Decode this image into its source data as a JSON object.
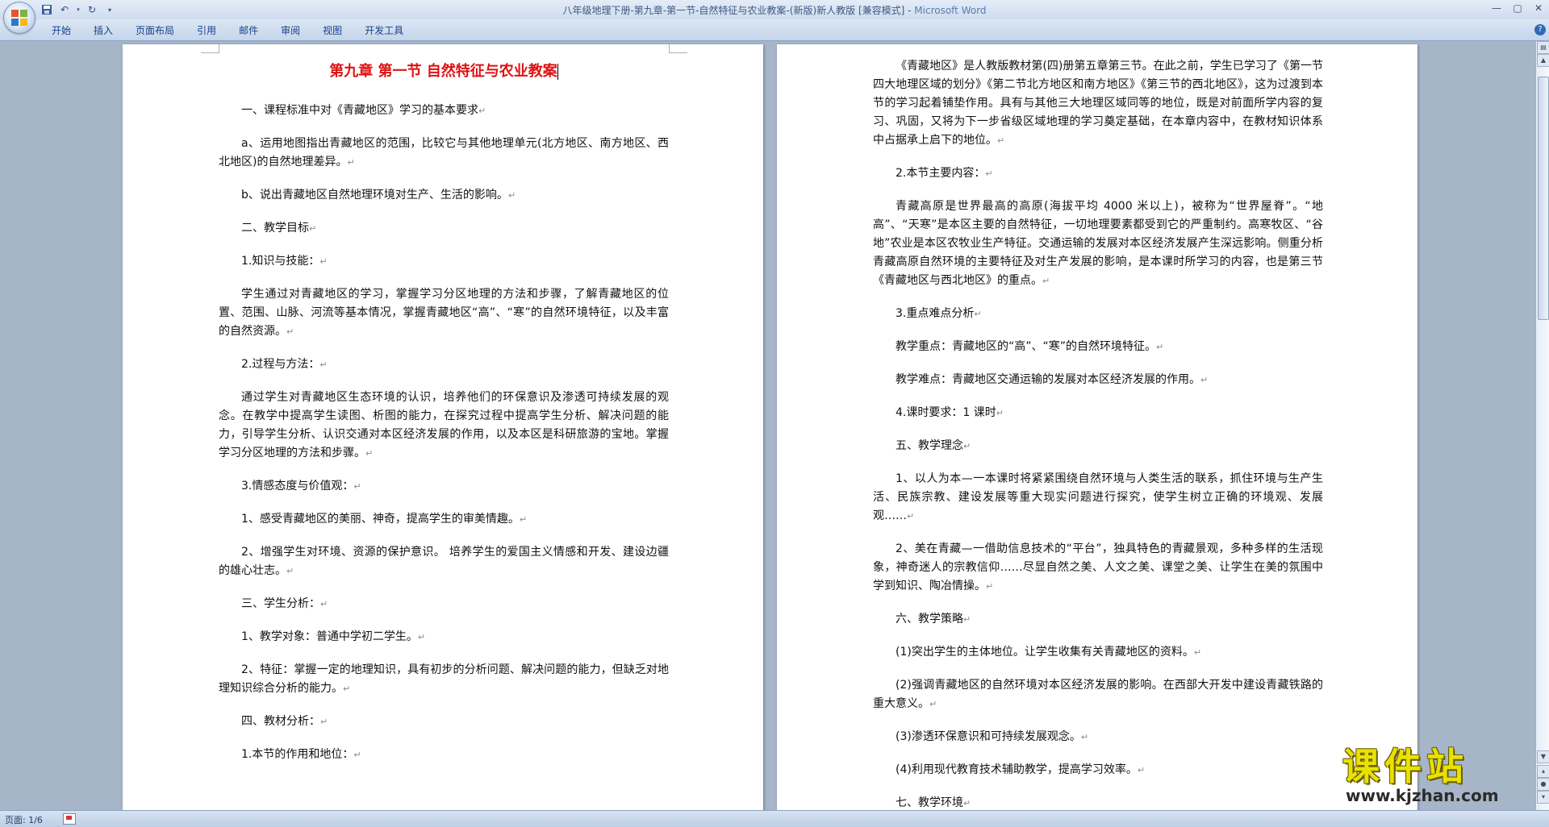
{
  "window": {
    "title": "八年级地理下册-第九章-第一节-自然特征与农业教案-(新版)新人教版 [兼容模式]",
    "separator": " - ",
    "app_name": "Microsoft Word"
  },
  "quick_access": {
    "icons": [
      "save-icon",
      "undo-icon",
      "redo-icon",
      "customize-icon"
    ]
  },
  "ribbon": {
    "tabs": [
      "开始",
      "插入",
      "页面布局",
      "引用",
      "邮件",
      "审阅",
      "视图",
      "开发工具"
    ]
  },
  "doc": {
    "title": "第九章  第一节  自然特征与农业教案",
    "left_paragraphs": [
      {
        "text": "一、课程标准中对《青藏地区》学习的基本要求",
        "indent": true
      },
      {
        "text": "a、运用地图指出青藏地区的范围，比较它与其他地理单元(北方地区、南方地区、西北地区)的自然地理差异。",
        "indent": true
      },
      {
        "text": "b、说出青藏地区自然地理环境对生产、生活的影响。",
        "indent": true
      },
      {
        "text": "二、教学目标",
        "indent": true
      },
      {
        "text": "1.知识与技能：",
        "indent": true
      },
      {
        "text": "学生通过对青藏地区的学习，掌握学习分区地理的方法和步骤，了解青藏地区的位置、范围、山脉、河流等基本情况，掌握青藏地区“高”、“寒”的自然环境特征，以及丰富的自然资源。",
        "indent": true
      },
      {
        "text": "2.过程与方法：",
        "indent": true
      },
      {
        "text": "通过学生对青藏地区生态环境的认识，培养他们的环保意识及渗透可持续发展的观念。在教学中提高学生读图、析图的能力，在探究过程中提高学生分析、解决问题的能力，引导学生分析、认识交通对本区经济发展的作用，以及本区是科研旅游的宝地。掌握学习分区地理的方法和步骤。",
        "indent": true
      },
      {
        "text": "3.情感态度与价值观：",
        "indent": true
      },
      {
        "text": "1、感受青藏地区的美丽、神奇，提高学生的审美情趣。",
        "indent": true
      },
      {
        "text": "2、增强学生对环境、资源的保护意识。 培养学生的爱国主义情感和开发、建设边疆的雄心壮志。",
        "indent": true
      },
      {
        "text": "三、学生分析：",
        "indent": true
      },
      {
        "text": "1、教学对象：普通中学初二学生。",
        "indent": true
      },
      {
        "text": "2、特征：掌握一定的地理知识，具有初步的分析问题、解决问题的能力，但缺乏对地理知识综合分析的能力。",
        "indent": true
      },
      {
        "text": "四、教材分析：",
        "indent": true
      },
      {
        "text": "1.本节的作用和地位：",
        "indent": true
      }
    ],
    "right_paragraphs": [
      {
        "text": "《青藏地区》是人教版教材第(四)册第五章第三节。在此之前，学生已学习了《第一节四大地理区域的划分》《第二节北方地区和南方地区》《第三节的西北地区》，这为过渡到本节的学习起着铺垫作用。具有与其他三大地理区域同等的地位，既是对前面所学内容的复习、巩固，又将为下一步省级区域地理的学习奠定基础，在本章内容中，在教材知识体系中占据承上启下的地位。",
        "indent": true
      },
      {
        "text": "2.本节主要内容：",
        "indent": true
      },
      {
        "text": "青藏高原是世界最高的高原(海拔平均 4000 米以上)，被称为“世界屋脊”。“地高”、“天寒”是本区主要的自然特征，一切地理要素都受到它的严重制约。高寒牧区、“谷地”农业是本区农牧业生产特征。交通运输的发展对本区经济发展产生深远影响。侧重分析青藏高原自然环境的主要特征及对生产发展的影响，是本课时所学习的内容，也是第三节《青藏地区与西北地区》的重点。",
        "indent": true
      },
      {
        "text": "3.重点难点分析",
        "indent": true
      },
      {
        "text": "教学重点：青藏地区的“高”、“寒”的自然环境特征。",
        "indent": true
      },
      {
        "text": "教学难点：青藏地区交通运输的发展对本区经济发展的作用。",
        "indent": true
      },
      {
        "text": "4.课时要求：1 课时",
        "indent": true
      },
      {
        "text": "五、教学理念",
        "indent": true
      },
      {
        "text": "1、以人为本—一本课时将紧紧围绕自然环境与人类生活的联系，抓住环境与生产生活、民族宗教、建设发展等重大现实问题进行探究，使学生树立正确的环境观、发展观……",
        "indent": true
      },
      {
        "text": "2、美在青藏—一借助信息技术的“平台”，独具特色的青藏景观，多种多样的生活现象，神奇迷人的宗教信仰……尽显自然之美、人文之美、课堂之美、让学生在美的氛围中学到知识、陶冶情操。",
        "indent": true
      },
      {
        "text": "六、教学策略",
        "indent": true
      },
      {
        "text": "(1)突出学生的主体地位。让学生收集有关青藏地区的资料。",
        "indent": true
      },
      {
        "text": "(2)强调青藏地区的自然环境对本区经济发展的影响。在西部大开发中建设青藏铁路的重大意义。",
        "indent": true
      },
      {
        "text": "(3)渗透环保意识和可持续发展观念。",
        "indent": true
      },
      {
        "text": "(4)利用现代教育技术辅助教学，提高学习效率。",
        "indent": true
      },
      {
        "text": "七、教学环境",
        "indent": true
      }
    ]
  },
  "status": {
    "page_indicator": "页面: 1/6"
  },
  "watermark": {
    "title": "课件站",
    "url": "www.kjzhan.com"
  },
  "colors": {
    "title_red": "#e01010",
    "watermark_yellow": "#e8e200"
  }
}
